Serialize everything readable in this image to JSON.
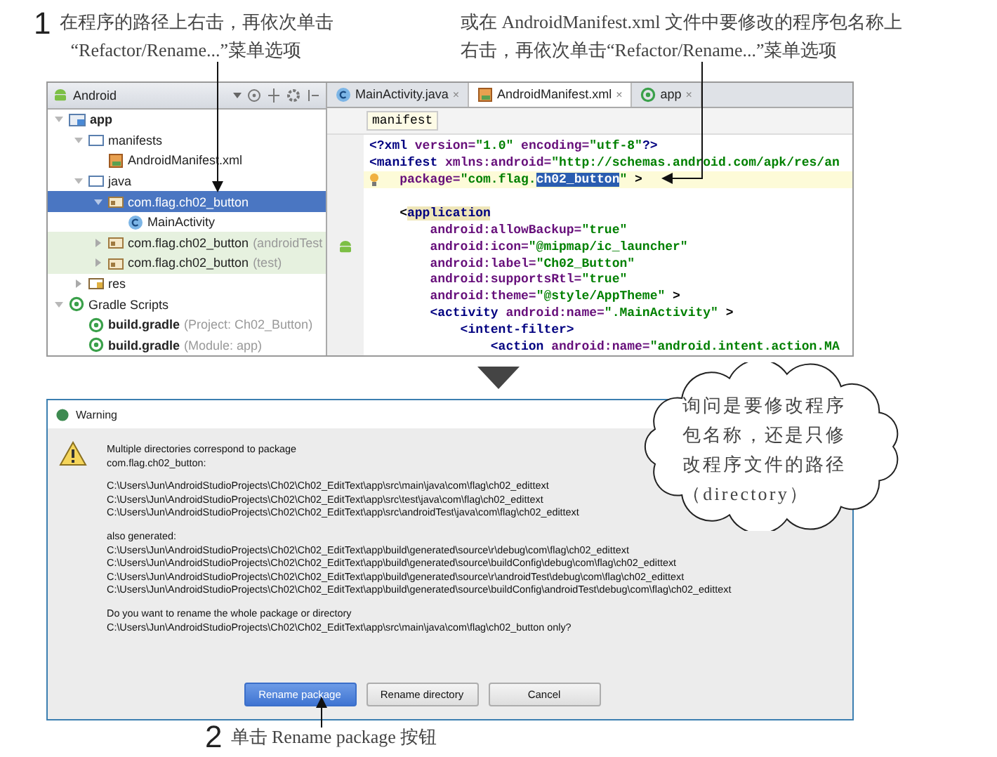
{
  "step1": {
    "number": "1",
    "lines": [
      "在程序的路径上右击，再依次单击",
      "“Refactor/Rename...”菜单选项"
    ]
  },
  "note": {
    "lines": [
      "或在 AndroidManifest.xml 文件中要修改的程序包名称上",
      "右击，再依次单击“Refactor/Rename...”菜单选项"
    ]
  },
  "project_panel": {
    "view": "Android",
    "tree": [
      {
        "label": "app",
        "kind": "module",
        "bold": true,
        "expanded": true,
        "selected": false,
        "children": [
          {
            "label": "manifests",
            "kind": "folder",
            "expanded": true,
            "selected": false,
            "children": [
              {
                "label": "AndroidManifest.xml",
                "kind": "xml",
                "selected": false
              }
            ]
          },
          {
            "label": "java",
            "kind": "folder",
            "expanded": true,
            "selected": false,
            "children": [
              {
                "label": "com.flag.ch02_button",
                "kind": "package",
                "expanded": true,
                "selected": true,
                "children": [
                  {
                    "label": "MainActivity",
                    "kind": "class",
                    "selected": false
                  }
                ]
              },
              {
                "label": "com.flag.ch02_button",
                "suffix": "(androidTest",
                "kind": "package",
                "expanded": false,
                "tinted": true,
                "selected": false
              },
              {
                "label": "com.flag.ch02_button",
                "suffix": "(test)",
                "kind": "package",
                "expanded": false,
                "tinted": true,
                "selected": false
              }
            ]
          },
          {
            "label": "res",
            "kind": "res",
            "expanded": false,
            "selected": false
          }
        ]
      },
      {
        "label": "Gradle Scripts",
        "kind": "gradle",
        "expanded": true,
        "selected": false,
        "children": [
          {
            "label": "build.gradle",
            "suffix": "(Project: Ch02_Button)",
            "kind": "gradle",
            "bold": true,
            "selected": false
          },
          {
            "label": "build.gradle",
            "suffix": "(Module: app)",
            "kind": "gradle",
            "bold": true,
            "selected": false
          }
        ]
      }
    ]
  },
  "editor": {
    "tabs": [
      {
        "label": "MainActivity.java",
        "kind": "class",
        "close": "×",
        "selected": false
      },
      {
        "label": "AndroidManifest.xml",
        "kind": "xml",
        "close": "×",
        "selected": true
      },
      {
        "label": "app",
        "kind": "gradle",
        "close": "×",
        "selected": false
      }
    ],
    "breadcrumb": "manifest",
    "lines": [
      {
        "tokens": [
          {
            "kind": "tag",
            "text": "<?xml "
          },
          {
            "kind": "attr",
            "text": "version="
          },
          {
            "kind": "value",
            "text": "\"1.0\""
          },
          {
            "kind": "attr",
            "text": " encoding="
          },
          {
            "kind": "value",
            "text": "\"utf-8\""
          },
          {
            "kind": "tag",
            "text": "?>"
          }
        ]
      },
      {
        "tokens": [
          {
            "kind": "tag",
            "text": "<manifest "
          },
          {
            "kind": "attr",
            "text": "xmlns:android="
          },
          {
            "kind": "value",
            "text": "\"http://schemas.android.com/apk/res/an"
          }
        ],
        "children": [
          {
            "kind": "hint",
            "highlighted": true,
            "tokens": [
              {
                "kind": "attr",
                "text": "package="
              },
              {
                "kind": "value",
                "text": "\"com.flag."
              },
              {
                "kind": "selection",
                "text": "ch02_button"
              },
              {
                "kind": "value",
                "text": "\""
              },
              {
                "kind": "plain",
                "text": " >"
              }
            ]
          },
          {
            "kind": "blank"
          },
          {
            "tokens": [
              {
                "kind": "plain",
                "text": "<"
              },
              {
                "kind": "match",
                "text": "application"
              }
            ],
            "children": [
              {
                "tokens": [
                  {
                    "kind": "attr",
                    "text": "android:allowBackup="
                  },
                  {
                    "kind": "value",
                    "text": "\"true\""
                  }
                ]
              },
              {
                "kind": "android",
                "tokens": [
                  {
                    "kind": "attr",
                    "text": "android:icon="
                  },
                  {
                    "kind": "value",
                    "text": "\"@mipmap/ic_launcher\""
                  }
                ]
              },
              {
                "tokens": [
                  {
                    "kind": "attr",
                    "text": "android:label="
                  },
                  {
                    "kind": "value",
                    "text": "\"Ch02_Button\""
                  }
                ]
              },
              {
                "tokens": [
                  {
                    "kind": "attr",
                    "text": "android:supportsRtl="
                  },
                  {
                    "kind": "value",
                    "text": "\"true\""
                  }
                ]
              },
              {
                "tokens": [
                  {
                    "kind": "attr",
                    "text": "android:theme="
                  },
                  {
                    "kind": "value",
                    "text": "\"@style/AppTheme\""
                  },
                  {
                    "kind": "plain",
                    "text": " >"
                  }
                ]
              },
              {
                "tokens": [
                  {
                    "kind": "tag",
                    "text": "<activity "
                  },
                  {
                    "kind": "attr",
                    "text": "android:name="
                  },
                  {
                    "kind": "value",
                    "text": "\".MainActivity\""
                  },
                  {
                    "kind": "plain",
                    "text": " >"
                  }
                ],
                "children": [
                  {
                    "tokens": [
                      {
                        "kind": "tag",
                        "text": "<intent-filter>"
                      }
                    ],
                    "children": [
                      {
                        "tokens": [
                          {
                            "kind": "tag",
                            "text": "<action "
                          },
                          {
                            "kind": "attr",
                            "text": "android:name="
                          },
                          {
                            "kind": "value",
                            "text": "\"android.intent.action.MA"
                          }
                        ]
                      }
                    ]
                  }
                ]
              }
            ]
          }
        ]
      }
    ]
  },
  "dialog": {
    "title": "Warning",
    "paragraphs": [
      [
        "Multiple directories correspond to package",
        "com.flag.ch02_button:"
      ],
      [
        "C:\\Users\\Jun\\AndroidStudioProjects\\Ch02\\Ch02_EditText\\app\\src\\main\\java\\com\\flag\\ch02_edittext",
        "C:\\Users\\Jun\\AndroidStudioProjects\\Ch02\\Ch02_EditText\\app\\src\\test\\java\\com\\flag\\ch02_edittext",
        "C:\\Users\\Jun\\AndroidStudioProjects\\Ch02\\Ch02_EditText\\app\\src\\androidTest\\java\\com\\flag\\ch02_edittext"
      ],
      [
        "also generated:",
        "C:\\Users\\Jun\\AndroidStudioProjects\\Ch02\\Ch02_EditText\\app\\build\\generated\\source\\r\\debug\\com\\flag\\ch02_edittext",
        "C:\\Users\\Jun\\AndroidStudioProjects\\Ch02\\Ch02_EditText\\app\\build\\generated\\source\\buildConfig\\debug\\com\\flag\\ch02_edittext",
        "C:\\Users\\Jun\\AndroidStudioProjects\\Ch02\\Ch02_EditText\\app\\build\\generated\\source\\r\\androidTest\\debug\\com\\flag\\ch02_edittext",
        "C:\\Users\\Jun\\AndroidStudioProjects\\Ch02\\Ch02_EditText\\app\\build\\generated\\source\\buildConfig\\androidTest\\debug\\com\\flag\\ch02_edittext"
      ],
      [
        "Do you want to rename the whole package or directory",
        "C:\\Users\\Jun\\AndroidStudioProjects\\Ch02\\Ch02_EditText\\app\\src\\main\\java\\com\\flag\\ch02_button only?"
      ]
    ],
    "buttons": [
      {
        "label": "Rename package",
        "selected": true
      },
      {
        "label": "Rename directory",
        "selected": false
      },
      {
        "label": "Cancel",
        "selected": false
      }
    ]
  },
  "callout": {
    "lines": [
      "询问是要修改程序",
      "包名称，还是只修",
      "改程序文件的路径",
      "（directory）"
    ]
  },
  "step2": {
    "number": "2",
    "text": "单击 Rename package 按钮"
  }
}
